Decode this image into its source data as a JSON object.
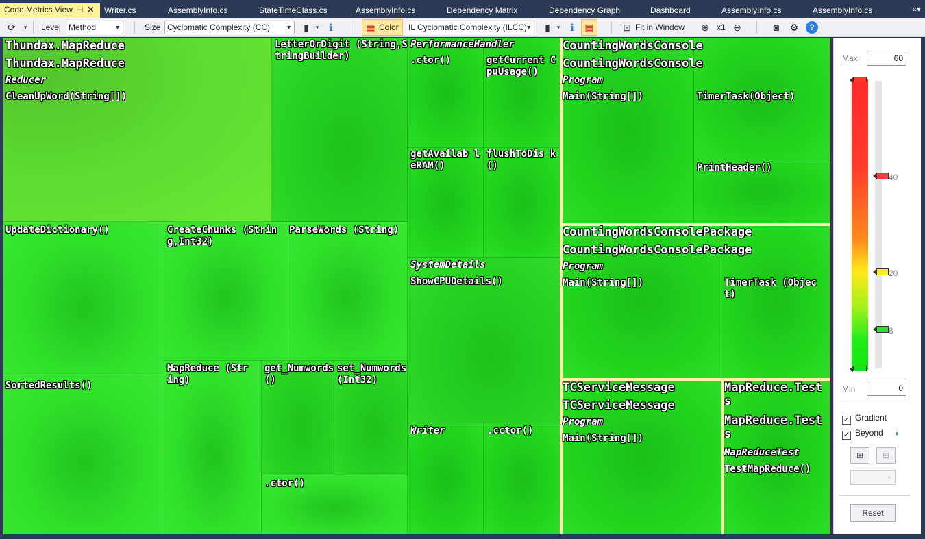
{
  "tabs": [
    {
      "label": "Code Metrics View",
      "active": true
    },
    {
      "label": "Writer.cs"
    },
    {
      "label": "AssemblyInfo.cs"
    },
    {
      "label": "StateTimeClass.cs"
    },
    {
      "label": "AssemblyInfo.cs"
    },
    {
      "label": "Dependency Matrix"
    },
    {
      "label": "Dependency Graph"
    },
    {
      "label": "Dashboard"
    },
    {
      "label": "AssemblyInfo.cs"
    },
    {
      "label": "AssemblyInfo.cs"
    }
  ],
  "tab_icons": {
    "pin": "pin-icon",
    "close": "close-icon",
    "overflow": "overflow-chevron-icon"
  },
  "toolbar": {
    "level_label": "Level",
    "level_value": "Method",
    "size_label": "Size",
    "size_value": "Cyclomatic Complexity (CC)",
    "color_label": "Color",
    "color_value": "IL Cyclomatic Complexity (ILCC)",
    "fit_label": "Fit in Window",
    "zoom_label": "x1"
  },
  "treemap": {
    "mapreduce": {
      "assembly": "Thundax.MapReduce",
      "namespace": "Thundax.MapReduce",
      "class_reducer": "Reducer",
      "cleanup": "CleanUpWord(String[])",
      "letterordigit": "LetterOrDigit (String,StringBuilder)",
      "updatedictionary": "UpdateDictionary()",
      "createchunks": "CreateChunks (String,Int32)",
      "parsewords": "ParseWords (String)",
      "sortedresults": "SortedResults()",
      "mapreduce": "MapReduce (String)",
      "get_numwords": "get_Numwords()",
      "set_numwords": "set_Numwords(Int32)",
      "ctor": ".ctor()",
      "class_perf": "PerformanceHandler",
      "perf_ctor": ".ctor()",
      "getcurrentcpu": "getCurrent CpuUsage()",
      "getavailableram": "getAvailab leRAM()",
      "flushtodisk": "flushToDis k()",
      "class_sysdetails": "SystemDetails",
      "showcpudetails": "ShowCPUDetails()",
      "class_writer": "Writer",
      "writer_cctor": ".cctor()"
    },
    "counting": {
      "assembly": "CountingWordsConsole",
      "namespace": "CountingWordsConsole",
      "class_program": "Program",
      "main": "Main(String[])",
      "timertask": "TimerTask(Object)",
      "printheader": "PrintHeader()"
    },
    "package": {
      "assembly": "CountingWordsConsolePackage",
      "namespace": "CountingWordsConsolePackage",
      "class_program": "Program",
      "main": "Main(String[])",
      "timertask": "TimerTask (Object)"
    },
    "tcservice": {
      "assembly": "TCServiceMessage",
      "namespace": "TCServiceMessage",
      "class_program": "Program",
      "main": "Main(String[])"
    },
    "tests": {
      "assembly": "MapReduce.Tests",
      "namespace": "MapReduce.Tests",
      "class_test": "MapReduceTest",
      "testmethod": "TestMapReduce()"
    }
  },
  "panel": {
    "max_label": "Max",
    "max_value": "60",
    "min_label": "Min",
    "min_value": "0",
    "ticks": [
      "40",
      "20",
      "8"
    ],
    "gradient_label": "Gradient",
    "beyond_label": "Beyond",
    "reset_label": "Reset"
  },
  "colors": {
    "tab_bg": "#2b3a55",
    "tab_active": "#fff29d",
    "cell_green": "#22d61e",
    "cell_light_green": "#5ddc31",
    "divider": "#fff4b0"
  }
}
